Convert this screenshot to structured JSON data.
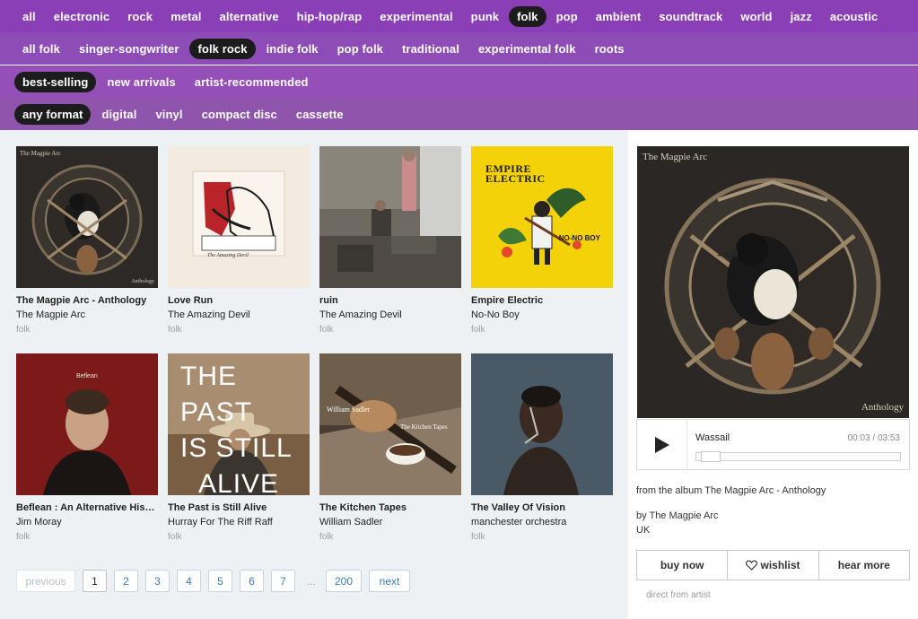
{
  "genres": [
    "all",
    "electronic",
    "rock",
    "metal",
    "alternative",
    "hip-hop/rap",
    "experimental",
    "punk",
    "folk",
    "pop",
    "ambient",
    "soundtrack",
    "world",
    "jazz",
    "acoustic"
  ],
  "genres_active": 8,
  "subgenres": [
    "all folk",
    "singer-songwriter",
    "folk rock",
    "indie folk",
    "pop folk",
    "traditional",
    "experimental folk",
    "roots"
  ],
  "subgenres_active": 2,
  "sorts": [
    "best-selling",
    "new arrivals",
    "artist-recommended"
  ],
  "sorts_active": 0,
  "formats": [
    "any format",
    "digital",
    "vinyl",
    "compact disc",
    "cassette"
  ],
  "formats_active": 0,
  "albums": [
    {
      "title": "The Magpie Arc - Anthology",
      "artist": "The Magpie Arc",
      "genre": "folk",
      "cover_text": [
        "The Magpie Arc",
        "Anthology"
      ]
    },
    {
      "title": "Love Run",
      "artist": "The Amazing Devil",
      "genre": "folk",
      "cover_text": [
        "The Amazing Devil"
      ]
    },
    {
      "title": "ruin",
      "artist": "The Amazing Devil",
      "genre": "folk",
      "cover_text": []
    },
    {
      "title": "Empire Electric",
      "artist": "No-No Boy",
      "genre": "folk",
      "cover_text": [
        "EMPIRE",
        "ELECTRIC",
        "NO-NO BOY"
      ]
    },
    {
      "title": "Beflean : An Alternative History of ...",
      "artist": "Jim Moray",
      "genre": "folk",
      "cover_text": [
        "Beflean"
      ]
    },
    {
      "title": "The Past is Still Alive",
      "artist": "Hurray For The Riff Raff",
      "genre": "folk",
      "cover_text": [
        "THE PAST",
        "IS STILL",
        "ALIVE"
      ]
    },
    {
      "title": "The Kitchen Tapes",
      "artist": "William Sadler",
      "genre": "folk",
      "cover_text": [
        "William Sadler",
        "The Kitchen Tapes"
      ]
    },
    {
      "title": "The Valley Of Vision",
      "artist": "manchester orchestra",
      "genre": "folk",
      "cover_text": []
    }
  ],
  "pager": {
    "previous": "previous",
    "pages": [
      "1",
      "2",
      "3",
      "4",
      "5",
      "6",
      "7"
    ],
    "current": "1",
    "ellipsis": "...",
    "last": "200",
    "next": "next"
  },
  "featured": {
    "cover_title": "The Magpie Arc",
    "cover_subtitle": "Anthology",
    "track": "Wassail",
    "time": "00:03 / 03:53",
    "progress": 0.013,
    "from_album": "from the album The Magpie Arc - Anthology",
    "by": "by The Magpie Arc",
    "country": "UK",
    "buy": "buy now",
    "wishlist": "wishlist",
    "hear_more": "hear more",
    "direct": "direct from artist"
  },
  "colors": {
    "bar1": "#8a3fb7",
    "bar2": "#8e4db6",
    "bar3": "#9450b8",
    "bar4": "#8f55ad",
    "active_pill": "#1c1c1c",
    "link": "#3b7cb0"
  }
}
